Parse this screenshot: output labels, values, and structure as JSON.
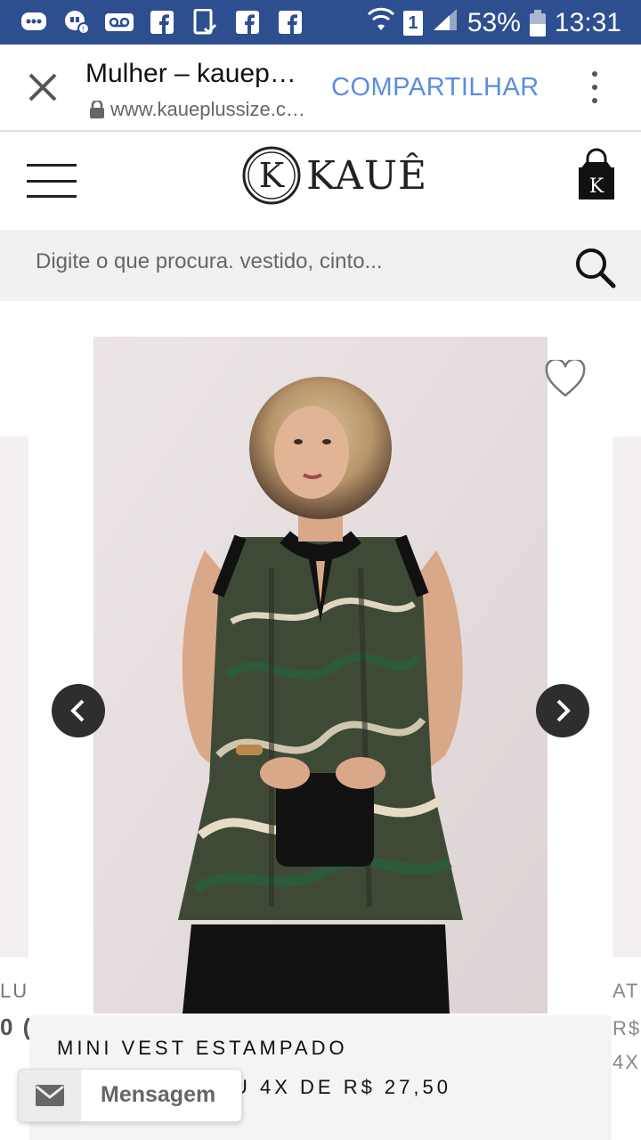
{
  "status_bar": {
    "battery": "53%",
    "time": "13:31",
    "sim_slot": "1",
    "notification_icons": [
      "chat-icon",
      "hangouts-icon",
      "voicemail-icon",
      "facebook-icon",
      "phone-check-icon",
      "facebook-icon",
      "facebook-icon"
    ]
  },
  "browser": {
    "title": "Mulher – kauep…",
    "url": "www.kaueplussize.c…",
    "share_label": "COMPARTILHAR"
  },
  "site": {
    "logo_text": "KAUÊ",
    "logo_mark": "K",
    "bag_letter": "K"
  },
  "search": {
    "placeholder": "Digite o que procura. vestido, cinto..."
  },
  "carousel": {
    "left_peek": {
      "line1": "LU",
      "line2": "0 ("
    },
    "right_peek": {
      "line1": "AT",
      "line2": "R$",
      "line3": "4X"
    }
  },
  "product": {
    "name": "MINI VEST ESTAMPADO",
    "price_fragment": "U 4X DE R$ 27,50"
  },
  "message_button": {
    "label": "Mensagem"
  },
  "colors": {
    "status_bar": "#2d4f8f",
    "share_link": "#5b8de0"
  }
}
